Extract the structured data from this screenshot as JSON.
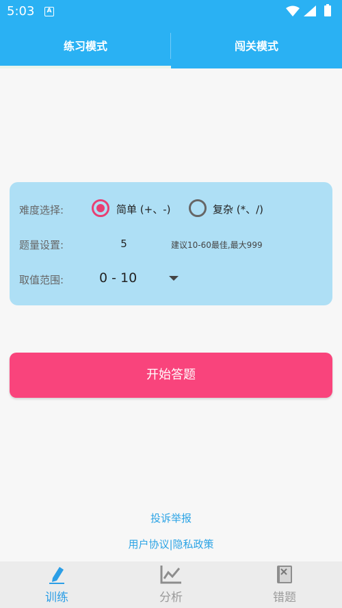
{
  "status": {
    "time": "5:03",
    "notif_glyph": "A"
  },
  "tabs": [
    {
      "label": "练习模式"
    },
    {
      "label": "闯关模式"
    }
  ],
  "settings": {
    "difficulty_label": "难度选择:",
    "option_simple": "简单 (+、-)",
    "option_complex": "复杂 (*、/)",
    "count_label": "题量设置:",
    "count_value": "5",
    "count_hint": "建议10-60最佳,最大999",
    "range_label": "取值范围:",
    "range_value": "0 - 10"
  },
  "start_button": "开始答题",
  "links": {
    "report": "投诉举报",
    "policy": "用户协议|隐私政策"
  },
  "nav": [
    {
      "label": "训练"
    },
    {
      "label": "分析"
    },
    {
      "label": "错题"
    }
  ],
  "colors": {
    "primary": "#2ab1f3",
    "accent": "#f9447c",
    "radio": "#e83f73",
    "card": "#aedff5"
  }
}
